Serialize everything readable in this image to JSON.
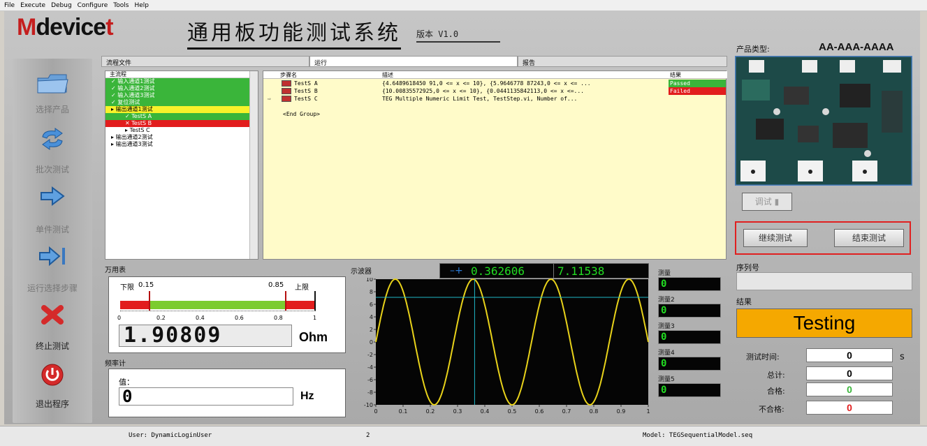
{
  "menu": [
    "File",
    "Execute",
    "Debug",
    "Configure",
    "Tools",
    "Help"
  ],
  "logo": {
    "m": "M",
    "rest": "device",
    "tail": "t"
  },
  "app_title": "通用板功能测试系统",
  "version": "版本 V1.0",
  "sidebar": [
    {
      "label": "选择产品",
      "icon": "folder-icon"
    },
    {
      "label": "批次测试",
      "icon": "cycle-arrows-icon"
    },
    {
      "label": "单件测试",
      "icon": "arrow-right-icon"
    },
    {
      "label": "运行选择步骤",
      "icon": "arrow-to-bar-icon"
    },
    {
      "label": "终止测试",
      "icon": "stop-x-icon"
    },
    {
      "label": "退出程序",
      "icon": "power-icon"
    }
  ],
  "tabs": [
    "流程文件",
    "运行",
    "报告"
  ],
  "tree": {
    "header": "主流程",
    "rows": [
      {
        "text": "输入通道1测试",
        "state": "green"
      },
      {
        "text": "输入通道2测试",
        "state": "green"
      },
      {
        "text": "输入通道3测试",
        "state": "green"
      },
      {
        "text": "复位测试",
        "state": "green"
      },
      {
        "text": "输出通道1测试",
        "state": "yellow"
      },
      {
        "text": "TestS A",
        "state": "green"
      },
      {
        "text": "TestS B",
        "state": "red"
      },
      {
        "text": "TestS C",
        "state": "none"
      },
      {
        "text": "输出通道2测试",
        "state": "none"
      },
      {
        "text": "输出通道3测试",
        "state": "none"
      }
    ]
  },
  "sequence": {
    "headers": [
      "步骤名",
      "描述",
      "结果"
    ],
    "rows": [
      {
        "name": "TestS A",
        "desc": "{4.6489618450 91,0 <= x <= 10}, {5.9646778 87243,0 <= x <= ...",
        "result": "Passed",
        "state": "passed"
      },
      {
        "name": "TestS B",
        "desc": "{10.00835572925,0 <= x <= 10}, {0.0441135842113,0 <= x <=...",
        "result": "Failed",
        "state": "failed"
      },
      {
        "name": "TestS C",
        "desc": "TEG Multiple Numeric Limit Test,  TestStep.vi,  Number of...",
        "result": "",
        "state": "current"
      }
    ],
    "end_group": "<End Group>"
  },
  "multimeter": {
    "title": "万用表",
    "low_label": "下限",
    "low": "0.15",
    "high": "0.85",
    "high_label": "上限",
    "scale": [
      "0",
      "0.2",
      "0.4",
      "0.6",
      "0.8",
      "1"
    ],
    "value": "1.90809",
    "unit": "Ohm"
  },
  "freq_meter": {
    "title": "频率计",
    "value_label": "值：",
    "value": "0",
    "unit": "Hz"
  },
  "scope": {
    "title": "示波器",
    "cursor_x": "0.362606",
    "cursor_y": "7.11538",
    "x_ticks": [
      "0",
      "0.1",
      "0.2",
      "0.3",
      "0.4",
      "0.5",
      "0.6",
      "0.7",
      "0.8",
      "0.9",
      "1"
    ],
    "y_ticks": [
      "10",
      "8",
      "6",
      "4",
      "2",
      "0",
      "-2",
      "-4",
      "-6",
      "-8",
      "-10"
    ]
  },
  "measurements": [
    {
      "label": "测量",
      "value": "0"
    },
    {
      "label": "测量2",
      "value": "0"
    },
    {
      "label": "测量3",
      "value": "0"
    },
    {
      "label": "测量4",
      "value": "0"
    },
    {
      "label": "测量5",
      "value": "0"
    }
  ],
  "right": {
    "product_type_label": "产品类型:",
    "product_type": "AA-AAA-AAAA",
    "debug_label": "调试",
    "continue_label": "继续测试",
    "end_label": "结束测试",
    "serial_label": "序列号",
    "result_label": "结果",
    "result_text": "Testing",
    "test_time_label": "测试时间:",
    "test_time": "0",
    "test_time_unit": "s",
    "total_label": "总计:",
    "total": "0",
    "pass_label": "合格:",
    "pass": "0",
    "fail_label": "不合格:",
    "fail": "0"
  },
  "status": {
    "user": "User: DynamicLoginUser",
    "count": "2",
    "model": "Model: TEGSequentialModel.seq"
  },
  "colors": {
    "pass": "#3ab53a",
    "fail": "#e21d1d",
    "running": "#f8f22a",
    "testing_bg": "#f5a800",
    "trace": "#e8d21a",
    "cursor": "#20b8c8"
  },
  "chart_data": {
    "type": "line",
    "title": "示波器",
    "xlim": [
      0,
      1
    ],
    "ylim": [
      -10,
      10
    ],
    "series": [
      {
        "function": "10*sin(2*pi*3.5*x)",
        "x": [
          0,
          0.0714,
          0.2143,
          0.3571,
          0.5,
          0.6429,
          0.7857,
          0.9286,
          1
        ],
        "y": [
          0,
          10,
          -10,
          10,
          -10,
          10,
          -10,
          10,
          0
        ]
      }
    ],
    "cursor": {
      "x": 0.362606,
      "y": 7.11538
    }
  }
}
